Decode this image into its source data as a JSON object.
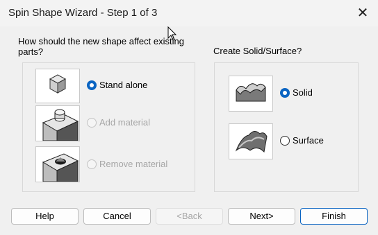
{
  "window": {
    "title": "Spin Shape Wizard - Step 1 of 3",
    "close_glyph": "✕"
  },
  "left_group": {
    "question": "How should the new shape affect existing parts?",
    "options": [
      {
        "label": "Stand alone",
        "selected": true,
        "enabled": true
      },
      {
        "label": "Add material",
        "selected": false,
        "enabled": false
      },
      {
        "label": "Remove material",
        "selected": false,
        "enabled": false
      }
    ]
  },
  "right_group": {
    "question": "Create Solid/Surface?",
    "options": [
      {
        "label": "Solid",
        "selected": true
      },
      {
        "label": "Surface",
        "selected": false
      }
    ]
  },
  "buttons": {
    "help": "Help",
    "cancel": "Cancel",
    "back": "<Back",
    "next": "Next>",
    "finish": "Finish"
  },
  "colors": {
    "accent": "#0a64c2",
    "disabled_text": "#a6a6a6"
  }
}
